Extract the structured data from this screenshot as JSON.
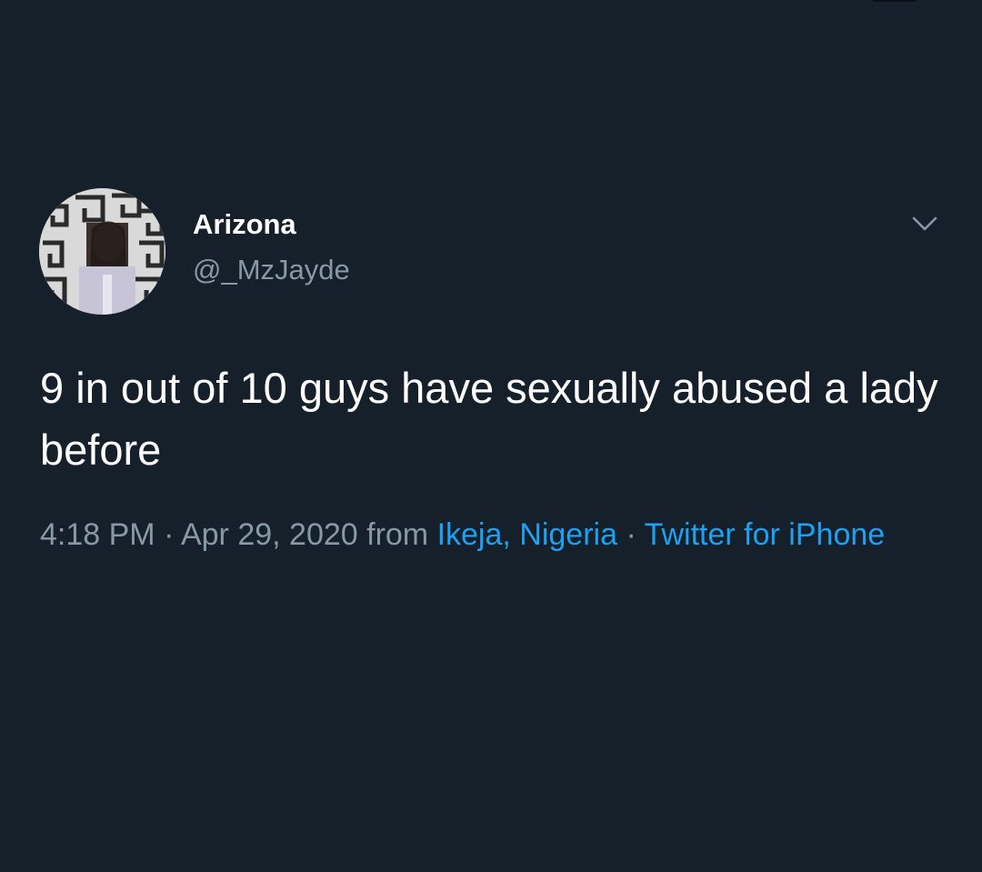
{
  "tweet": {
    "display_name": "Arizona",
    "handle": "@_MzJayde",
    "text": "9 in out of 10 guys have sexually abused a lady before",
    "time": "4:18 PM",
    "separator_1": " · ",
    "date": "Apr 29, 2020",
    "from_label": " from ",
    "location": "Ikeja, Nigeria",
    "separator_2": " · ",
    "source": "Twitter for iPhone"
  },
  "icons": {
    "menu": "chevron-down-icon",
    "avatar": "profile-photo"
  },
  "colors": {
    "background": "#15202b",
    "primary_text": "#ffffff",
    "secondary_text": "#8899a6",
    "link": "#1da1f2"
  }
}
